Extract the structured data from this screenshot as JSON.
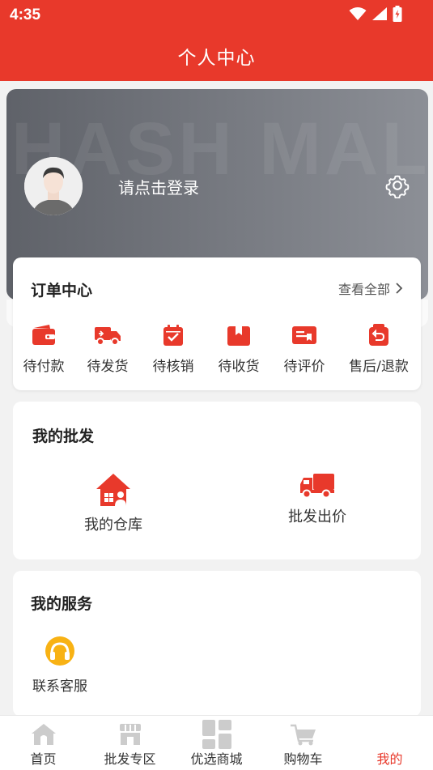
{
  "status": {
    "time": "4:35"
  },
  "header": {
    "title": "个人中心"
  },
  "profile": {
    "watermark": "HASH MALL",
    "login_text": "请点击登录"
  },
  "orders": {
    "title": "订单中心",
    "view_all": "查看全部",
    "items": [
      {
        "label": "待付款",
        "icon": "wallet-icon"
      },
      {
        "label": "待发货",
        "icon": "delivery-truck-icon"
      },
      {
        "label": "待核销",
        "icon": "calendar-check-icon"
      },
      {
        "label": "待收货",
        "icon": "package-box-icon"
      },
      {
        "label": "待评价",
        "icon": "review-card-icon"
      },
      {
        "label": "售后/退款",
        "icon": "refund-bag-icon"
      }
    ]
  },
  "wholesale": {
    "title": "我的批发",
    "items": [
      {
        "label": "我的仓库",
        "icon": "warehouse-icon"
      },
      {
        "label": "批发出价",
        "icon": "truck-icon"
      }
    ]
  },
  "services": {
    "title": "我的服务",
    "items": [
      {
        "label": "联系客服",
        "icon": "headset-icon"
      }
    ]
  },
  "tabbar": {
    "items": [
      {
        "label": "首页",
        "icon": "home-icon"
      },
      {
        "label": "批发专区",
        "icon": "store-icon"
      },
      {
        "label": "优选商城",
        "icon": "grid-icon"
      },
      {
        "label": "购物车",
        "icon": "cart-icon"
      },
      {
        "label": "我的",
        "icon": "user-icon",
        "active": true
      }
    ]
  },
  "colors": {
    "accent": "#e8392b",
    "inactive_icon": "#cccccc"
  }
}
